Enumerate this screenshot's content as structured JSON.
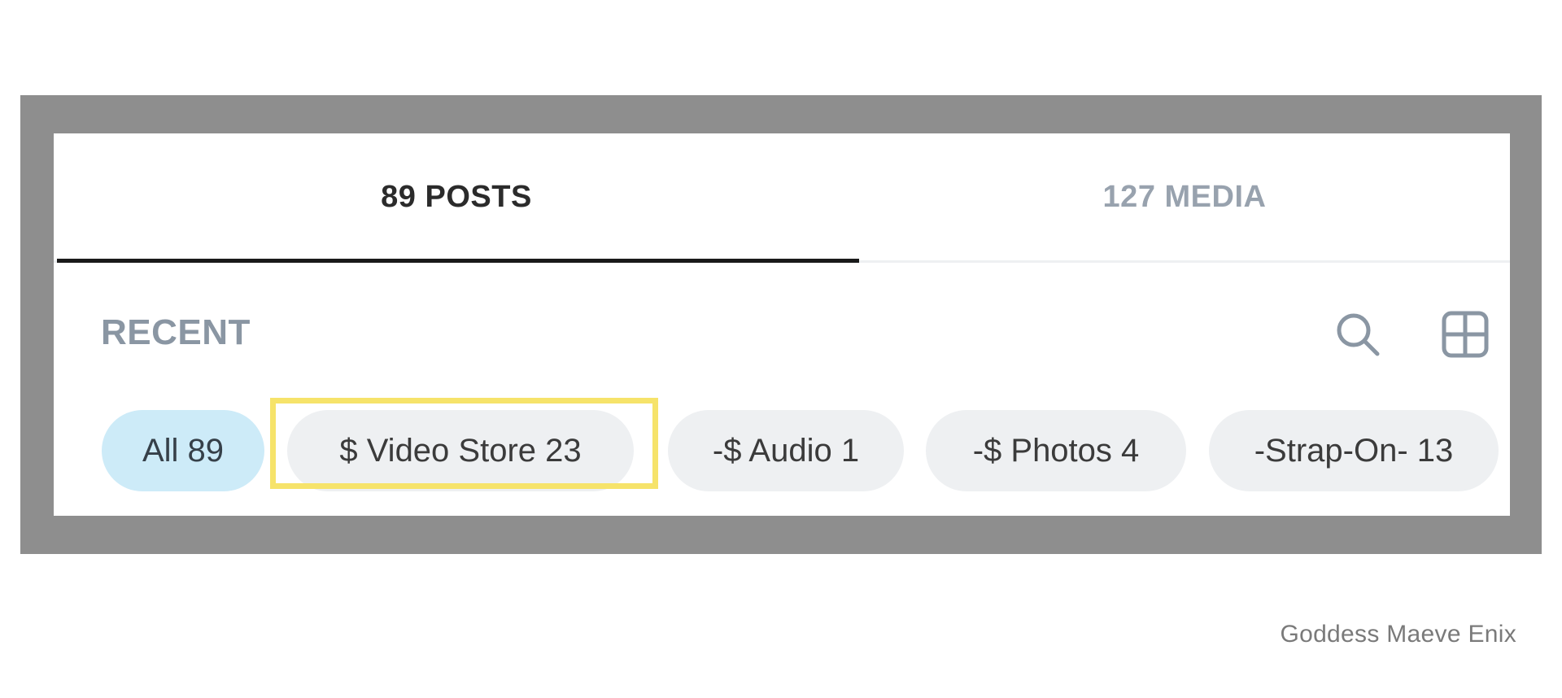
{
  "tabs": [
    {
      "label": "89 POSTS",
      "active": true
    },
    {
      "label": "127 MEDIA",
      "active": false
    }
  ],
  "section": {
    "title": "RECENT"
  },
  "toolbar": {
    "icons": [
      "search-icon",
      "grid-view-icon"
    ]
  },
  "chips": [
    {
      "label": "All 89",
      "selected": true
    },
    {
      "label": "$ Video Store 23",
      "selected": false,
      "highlighted": true
    },
    {
      "label": "-$ Audio 1",
      "selected": false
    },
    {
      "label": "-$ Photos 4",
      "selected": false
    },
    {
      "label": "-Strap-On- 13",
      "selected": false
    }
  ],
  "watermark": "Goddess Maeve Enix",
  "colors": {
    "frame": "#8e8e8e",
    "active_chip": "#cdebf8",
    "chip": "#eef0f2",
    "highlight": "#f6e36a",
    "tab_active_text": "#2b2b2b",
    "tab_inactive_text": "#98a2ae"
  }
}
